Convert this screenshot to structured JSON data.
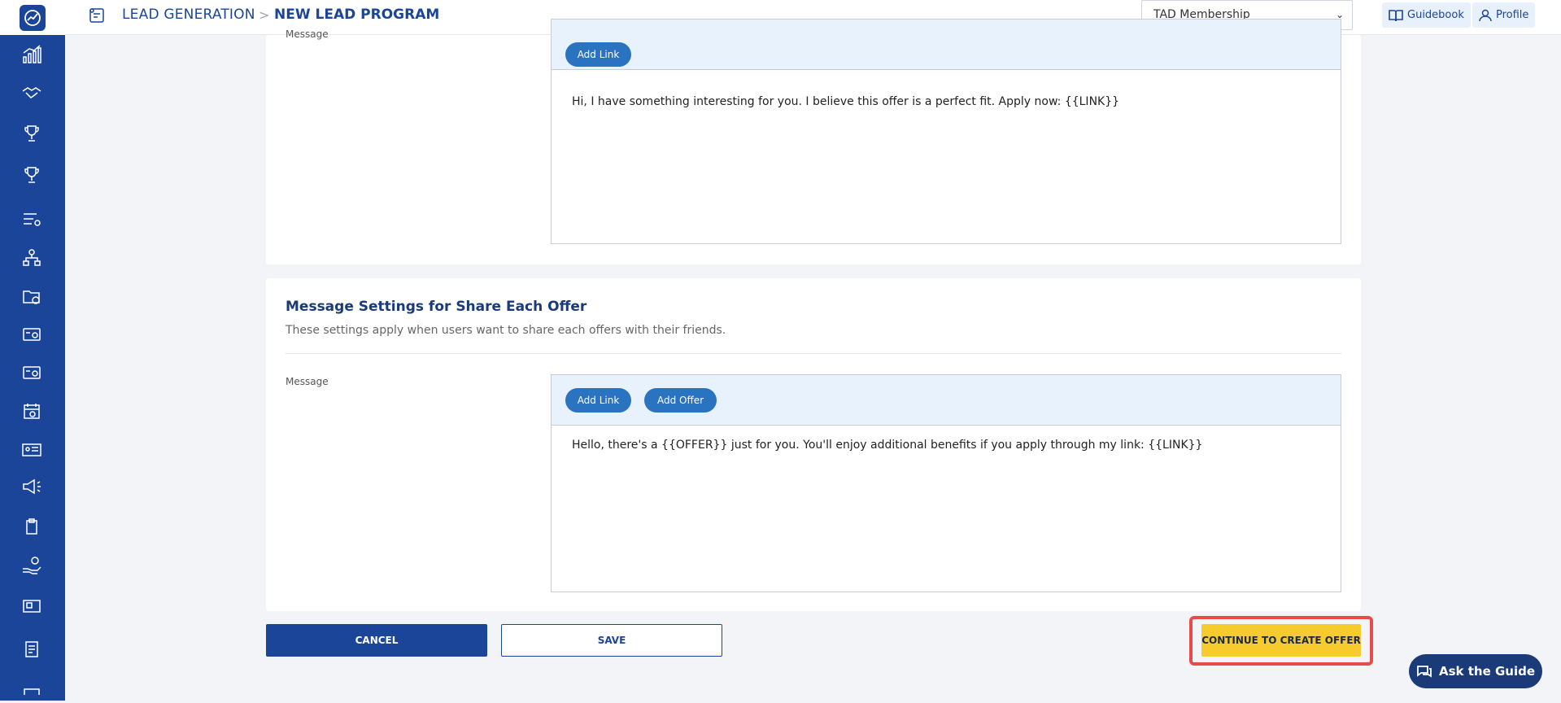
{
  "header": {
    "breadcrumb_section": "LEAD GENERATION",
    "breadcrumb_separator": ">",
    "breadcrumb_page": "NEW LEAD PROGRAM",
    "membership_select_value": "TAD Membership",
    "guidebook_label": "Guidebook",
    "profile_label": "Profile"
  },
  "sidebar": {
    "icons": [
      "analytics-icon",
      "handshake-icon",
      "trophy-icon",
      "trophy-alt-icon",
      "list-settings-icon",
      "org-chart-icon",
      "folder-clock-icon",
      "card-settings-icon",
      "card-settings-alt-icon",
      "calendar-icon",
      "id-card-icon",
      "megaphone-icon",
      "clipboard-icon",
      "hand-coin-icon",
      "image-card-icon",
      "document-icon"
    ]
  },
  "section_one": {
    "message_label": "Message",
    "add_link_label": "Add Link",
    "message_text": "Hi, I have something interesting for you. I believe this offer is a perfect fit. Apply now: {{LINK}}"
  },
  "section_two": {
    "title": "Message Settings for Share Each Offer",
    "subtitle": "These settings apply when users want to share each offers with their friends.",
    "message_label": "Message",
    "add_link_label": "Add Link",
    "add_offer_label": "Add Offer",
    "message_text": "Hello, there's a {{OFFER}} just for you. You'll enjoy additional benefits if you apply through my link: {{LINK}}"
  },
  "actions": {
    "cancel_label": "CANCEL",
    "save_label": "SAVE",
    "continue_label": "CONTINUE TO CREATE OFFER"
  },
  "chat": {
    "ask_guide_label": "Ask the Guide"
  },
  "colors": {
    "brand_navy": "#1b4599",
    "pill_blue": "#2a73c1",
    "accent_yellow": "#f5cb2d",
    "highlight_red": "#e94b4b"
  }
}
